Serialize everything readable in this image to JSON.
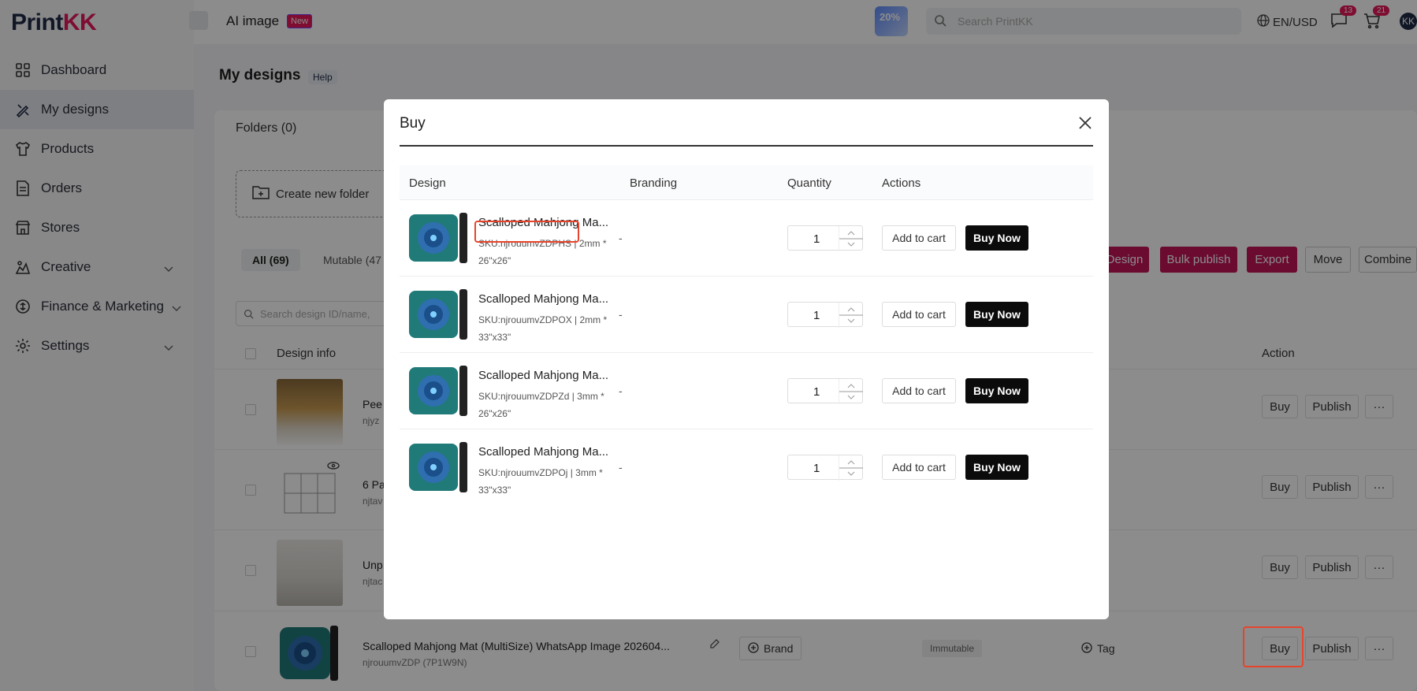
{
  "sidebar": {
    "logo_main": "Print",
    "logo_accent": "KK",
    "items": [
      {
        "label": "Dashboard",
        "icon": "dashboard-icon"
      },
      {
        "label": "My designs",
        "icon": "designs-icon"
      },
      {
        "label": "Products",
        "icon": "shirt-icon"
      },
      {
        "label": "Orders",
        "icon": "orders-icon"
      },
      {
        "label": "Stores",
        "icon": "store-icon"
      },
      {
        "label": "Creative",
        "icon": "creative-icon"
      },
      {
        "label": "Finance & Marketing",
        "icon": "finance-icon"
      },
      {
        "label": "Settings",
        "icon": "gear-icon"
      }
    ]
  },
  "topbar": {
    "ai_label": "AI image",
    "new_badge": "New",
    "promo": "20%",
    "search_placeholder": "Search PrintKK",
    "lang": "EN/USD",
    "msg_count": "13",
    "cart_count": "21",
    "avatar": "KK"
  },
  "main": {
    "title": "My designs",
    "help": "Help",
    "folders": "Folders (0)",
    "create_folder": "Create new folder",
    "tab_all": "All (69)",
    "tab_mutable": "Mutable (47",
    "search_placeholder": "Search design ID/name,",
    "header_info": "Design info",
    "header_action": "Action",
    "toolbar": {
      "design": "Design",
      "bulk_publish": "Bulk publish",
      "export": "Export",
      "move": "Move",
      "combine": "Combine"
    },
    "rows": [
      {
        "title": "Pee",
        "sub": "njyz"
      },
      {
        "title": "6 Pa",
        "sub": "njtav"
      },
      {
        "title": "Unp",
        "sub": "njtac"
      },
      {
        "title": "Scalloped Mahjong Mat (MultiSize) WhatsApp Image 202604...",
        "sub": "njrouumvZDP (7P1W9N)",
        "brand": "Brand",
        "immutable": "Immutable",
        "tag": "Tag"
      }
    ],
    "buy": "Buy",
    "publish": "Publish",
    "more": "···"
  },
  "modal": {
    "title": "Buy",
    "headers": {
      "design": "Design",
      "branding": "Branding",
      "quantity": "Quantity",
      "actions": "Actions"
    },
    "rows": [
      {
        "name": "Scalloped Mahjong Ma...",
        "sku": "SKU:njrouumvZDPHS",
        "spec": " | 2mm * 26\"x26\"",
        "brand": "-",
        "qty": "1"
      },
      {
        "name": "Scalloped Mahjong Ma...",
        "sku": "SKU:njrouumvZDPOX",
        "spec": " | 2mm * 33\"x33\"",
        "brand": "-",
        "qty": "1"
      },
      {
        "name": "Scalloped Mahjong Ma...",
        "sku": "SKU:njrouumvZDPZd",
        "spec": " | 3mm * 26\"x26\"",
        "brand": "-",
        "qty": "1"
      },
      {
        "name": "Scalloped Mahjong Ma...",
        "sku": "SKU:njrouumvZDPOj",
        "spec": " | 3mm * 33\"x33\"",
        "brand": "-",
        "qty": "1"
      }
    ],
    "add_to_cart": "Add to cart",
    "buy_now": "Buy Now"
  }
}
